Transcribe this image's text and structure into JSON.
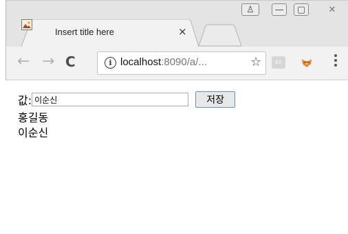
{
  "browser": {
    "tab_title": "Insert title here",
    "tab_close": "×",
    "url_host": "localhost",
    "url_rest": ":8090/a/...",
    "info_glyph": "i",
    "star_glyph": "☆",
    "ext1_label": "EX",
    "back_glyph": "←",
    "forward_glyph": "→",
    "reload_glyph": "C",
    "profile_glyph": "♙",
    "minimize_glyph": "—",
    "maximize_glyph": "▢",
    "close_glyph": "✕"
  },
  "page": {
    "label": "값:",
    "input_value": "이순신",
    "save_label": "저장",
    "items": [
      "홍길동",
      "이순신"
    ]
  },
  "icons": {
    "tab_favicon": "image-icon",
    "extension_1": "extension-icon",
    "extension_2": "fox-extension-icon"
  },
  "colors": {
    "titlebar": "#e4e4e4",
    "toolbar": "#f2f2f2",
    "button_border": "#5a8fd2"
  }
}
